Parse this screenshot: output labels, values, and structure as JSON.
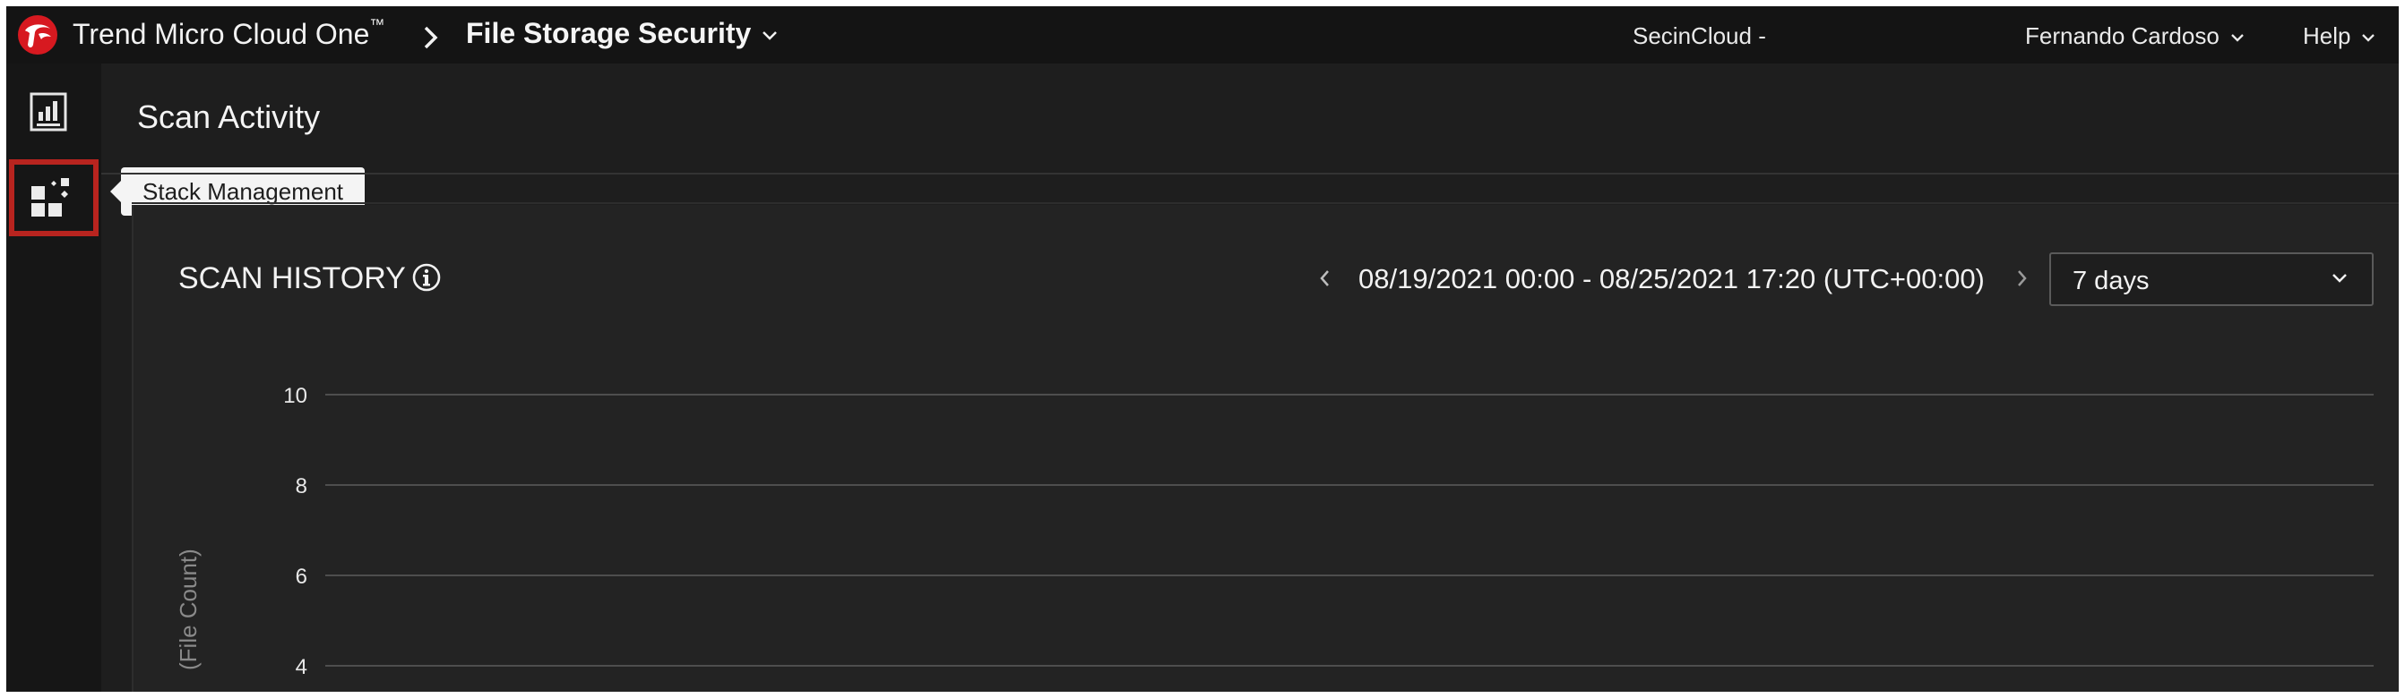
{
  "header": {
    "brand": "Trend Micro Cloud One",
    "brand_tm": "™",
    "product": "File Storage Security",
    "account": "SecinCloud -",
    "user": "Fernando Cardoso",
    "help": "Help"
  },
  "sidenav": {
    "items": [
      {
        "icon": "dashboard-chart-icon",
        "label": "Scan Activity"
      },
      {
        "icon": "stack-management-icon",
        "label": "Stack Management"
      }
    ],
    "tooltip": "Stack Management",
    "highlight_color": "#b8241f"
  },
  "page": {
    "title": "Scan Activity"
  },
  "scan_history": {
    "title": "SCAN HISTORY",
    "date_range": "08/19/2021 00:00 - 08/25/2021 17:20 (UTC+00:00)",
    "period": "7 days"
  },
  "chart_data": {
    "type": "line",
    "ylabel": "(File Count)",
    "yticks": [
      "10",
      "8",
      "6",
      "4"
    ],
    "ylim": [
      4,
      10
    ],
    "grid": true,
    "series": []
  },
  "colors": {
    "background": "#1e1e1e",
    "topbar": "#141414",
    "accent_red": "#d71920"
  }
}
